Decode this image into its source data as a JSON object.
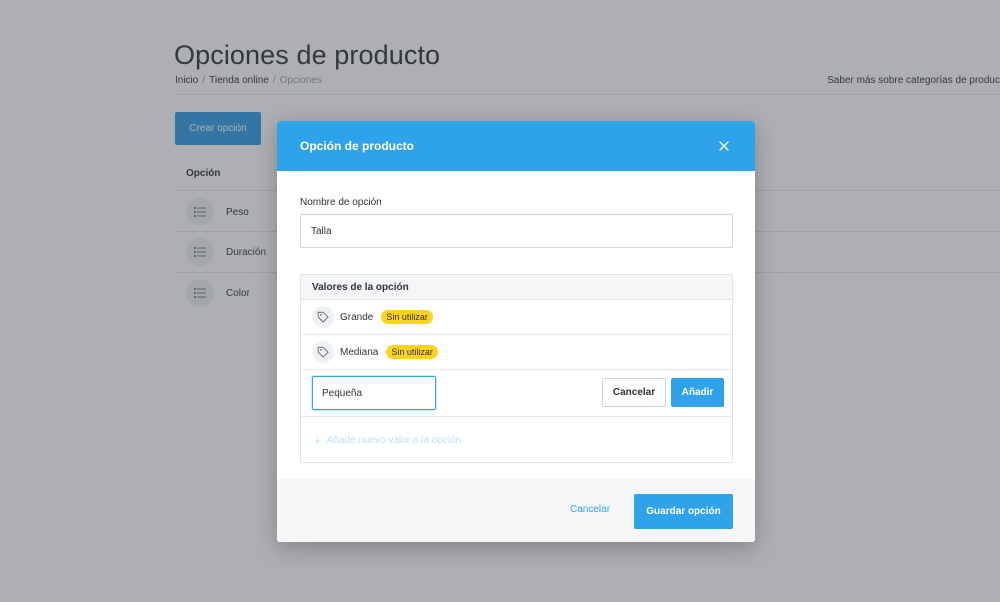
{
  "page": {
    "title": "Opciones de producto",
    "breadcrumb": [
      "Inicio",
      "Tienda online",
      "Opciones"
    ],
    "help_link": "Saber más sobre categorías de produc",
    "create_button": "Crear opción",
    "table_header": "Opción",
    "options": [
      {
        "label": "Peso",
        "icon": "list-icon"
      },
      {
        "label": "Duración",
        "icon": "list-icon"
      },
      {
        "label": "Color",
        "icon": "list-icon"
      }
    ]
  },
  "modal": {
    "title": "Opción de producto",
    "close_icon": "close-icon",
    "name_label": "Nombre de opción",
    "name_value": "Talla",
    "values_header": "Valores de la opción",
    "values": [
      {
        "label": "Grande",
        "badge": "Sin utilizar",
        "icon": "tag-icon"
      },
      {
        "label": "Mediana",
        "badge": "Sin utilizar",
        "icon": "tag-icon"
      }
    ],
    "new_value": "Pequeña",
    "row_cancel": "Cancelar",
    "row_add": "Añadir",
    "add_link": "Añade nuevo valor a la opción",
    "footer_cancel": "Cancelar",
    "footer_save": "Guardar opción"
  },
  "colors": {
    "accent": "#2fa3ea",
    "badge": "#ffd21f"
  }
}
